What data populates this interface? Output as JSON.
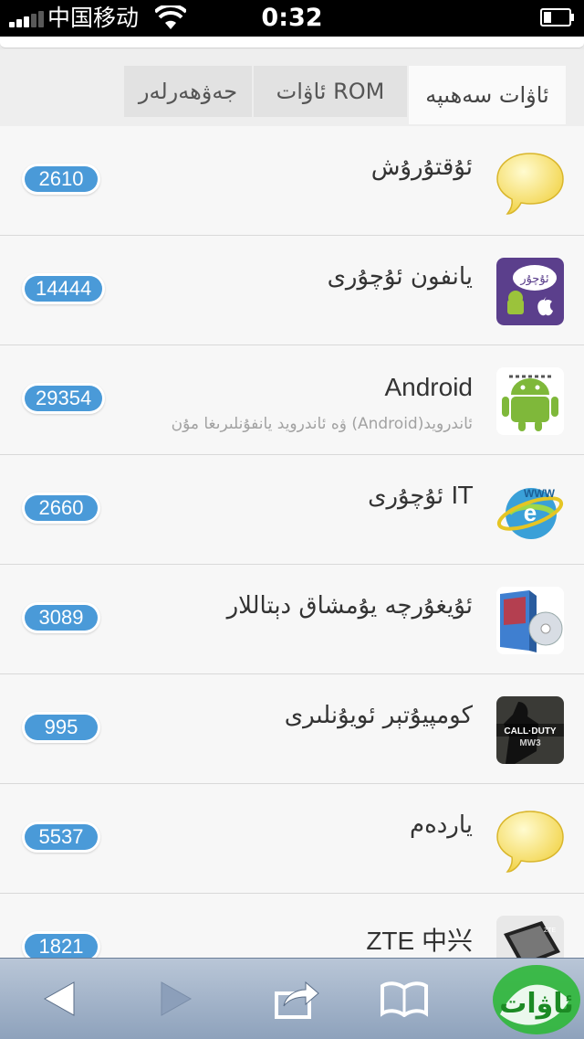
{
  "status_bar": {
    "carrier": "中国移动",
    "time": "0:32"
  },
  "tabs": [
    {
      "label": "ئاۋات سەھىپە",
      "active": true
    },
    {
      "label": "ئاۋات ROM",
      "active": false
    },
    {
      "label": "جەۋھەرلەر",
      "active": false
    }
  ],
  "list": [
    {
      "title": "ئۇقتۇرۇش",
      "count": "2610",
      "icon": "chat-bubble-icon"
    },
    {
      "title": "يانفون ئۇچۇرى",
      "count": "14444",
      "icon": "uyghur-phone-app-icon"
    },
    {
      "title": "Android",
      "subtitle": "ئاندرويد(Android) ۋە ئاندرويد يانفۇنلىرىغا مۇن",
      "count": "29354",
      "icon": "android-robot-icon"
    },
    {
      "title": "IT ئۇچۇرى",
      "count": "2660",
      "icon": "internet-explorer-globe-icon"
    },
    {
      "title": "ئۇيغۇرچە يۇمشاق دېتاللار",
      "count": "3089",
      "icon": "software-box-cd-icon"
    },
    {
      "title": "كومپيۇتېر ئويۇنلىرى",
      "count": "995",
      "icon": "call-of-duty-game-icon"
    },
    {
      "title": "ياردەم",
      "count": "5537",
      "icon": "chat-bubble-icon"
    },
    {
      "title": "ZTE 中兴",
      "count": "1821",
      "icon": "zte-phone-icon"
    }
  ],
  "toolbar": {
    "icons": [
      "back-arrow-icon",
      "forward-arrow-icon",
      "share-icon",
      "bookmarks-book-icon"
    ],
    "logo_text": "ئاۋات"
  },
  "colors": {
    "badge": "#4a9ad8",
    "toolbar": "#9fb0c6"
  }
}
